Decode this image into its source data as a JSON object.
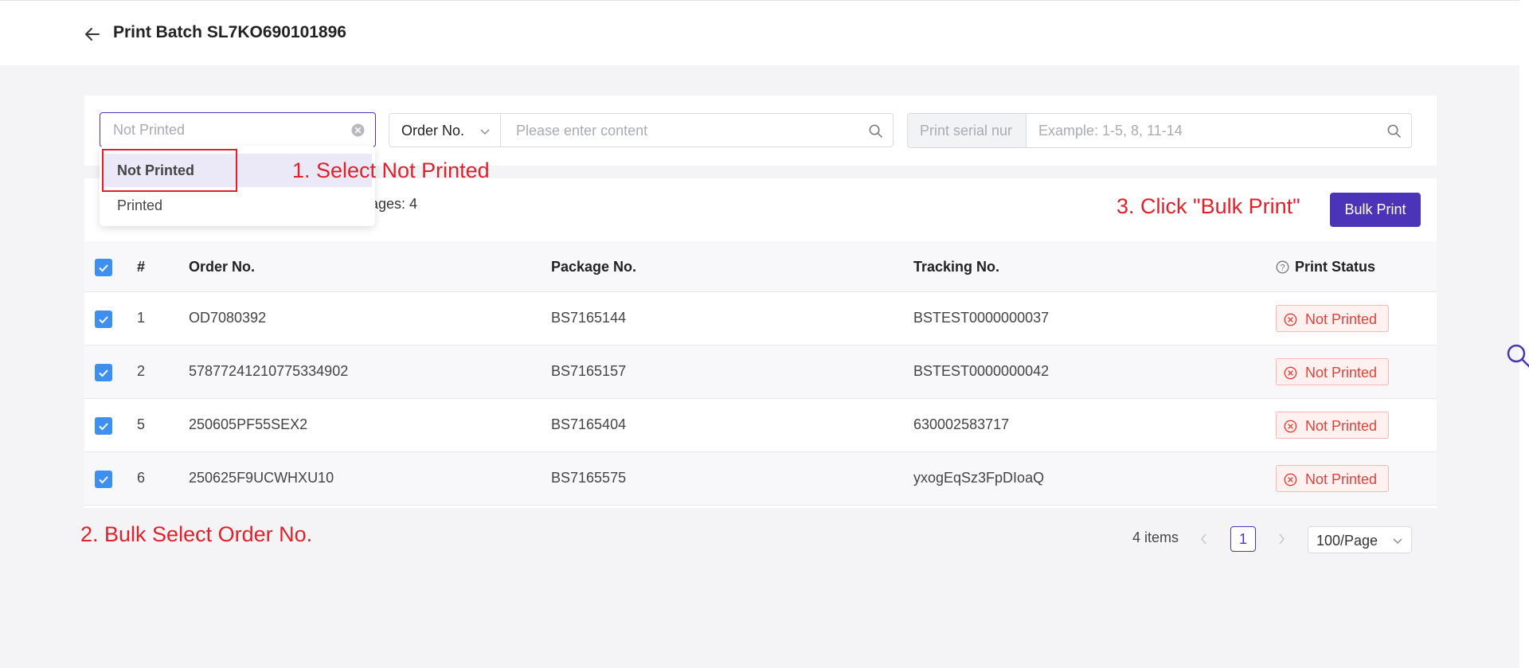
{
  "header": {
    "title": "Print Batch SL7KO690101896"
  },
  "filters": {
    "status_placeholder": "Not Printed",
    "field_select": "Order No.",
    "content_placeholder": "Please enter content",
    "serial_label": "Print serial nur",
    "serial_placeholder": "Example: 1-5, 8, 11-14"
  },
  "dropdown": {
    "options": [
      "Not Printed",
      "Printed"
    ]
  },
  "toolbar": {
    "pages_text": "ages: 4",
    "bulk_print_label": "Bulk Print"
  },
  "table": {
    "columns": [
      "#",
      "Order No.",
      "Package No.",
      "Tracking No.",
      "Print Status"
    ],
    "rows": [
      {
        "num": "1",
        "order": "OD7080392",
        "package": "BS7165144",
        "tracking": "BSTEST0000000037",
        "status": "Not Printed"
      },
      {
        "num": "2",
        "order": "57877241210775334902",
        "package": "BS7165157",
        "tracking": "BSTEST0000000042",
        "status": "Not Printed"
      },
      {
        "num": "5",
        "order": "250605PF55SEX2",
        "package": "BS7165404",
        "tracking": "630002583717",
        "status": "Not Printed"
      },
      {
        "num": "6",
        "order": "250625F9UCWHXU10",
        "package": "BS7165575",
        "tracking": "yxogEqSz3FpDIoaQ",
        "status": "Not Printed"
      }
    ]
  },
  "pagination": {
    "total": "4 items",
    "current": "1",
    "page_size": "100/Page"
  },
  "annotations": {
    "step1": "1. Select Not Printed",
    "step2": "2. Bulk Select Order No.",
    "step3": "3. Click \"Bulk Print\""
  },
  "colors": {
    "accent": "#4b34b8",
    "checkbox": "#3d8ff0",
    "status_red": "#e0423a",
    "annotation_red": "#e0202a"
  }
}
